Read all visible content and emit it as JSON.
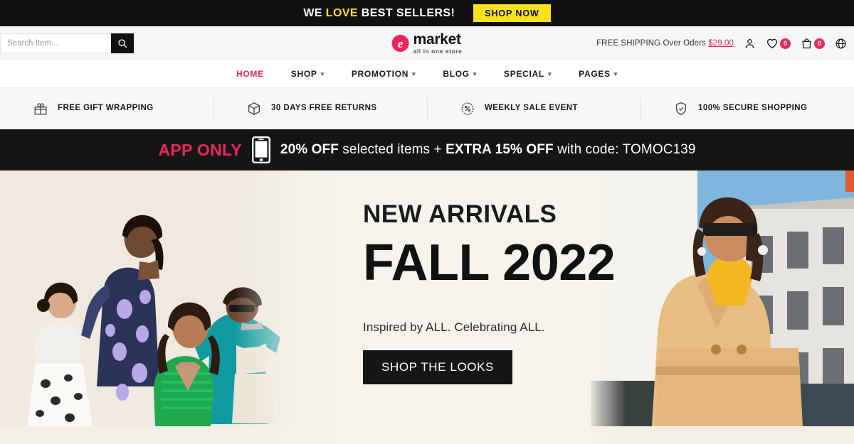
{
  "topbar": {
    "text_before": "WE ",
    "text_highlight": "LOVE",
    "text_after": " BEST SELLERS!",
    "button_label": "SHOP NOW",
    "highlight_color": "#f7e223",
    "button_bg": "#f7e11e"
  },
  "header": {
    "search_placeholder": "Search Item...",
    "search_value": "",
    "logo_mark": "e",
    "logo_name": "market",
    "logo_tagline": "all in one store",
    "shipping_note": "FREE SHIPPING Over Oders ",
    "shipping_price": "$29.00",
    "wishlist_count": "0",
    "cart_count": "0",
    "accent_color": "#e8285c"
  },
  "nav": {
    "items": [
      {
        "label": "HOME",
        "has_chevron": false,
        "active": true
      },
      {
        "label": "SHOP",
        "has_chevron": true,
        "active": false
      },
      {
        "label": "PROMOTION",
        "has_chevron": true,
        "active": false
      },
      {
        "label": "BLOG",
        "has_chevron": true,
        "active": false
      },
      {
        "label": "SPECIAL",
        "has_chevron": true,
        "active": false
      },
      {
        "label": "PAGES",
        "has_chevron": true,
        "active": false
      }
    ]
  },
  "features": [
    {
      "icon": "gift-icon",
      "label": "FREE GIFT WRAPPING"
    },
    {
      "icon": "box-icon",
      "label": "30 DAYS FREE RETURNS"
    },
    {
      "icon": "percent-badge-icon",
      "label": "WEEKLY SALE EVENT"
    },
    {
      "icon": "shield-check-icon",
      "label": "100% SECURE SHOPPING"
    }
  ],
  "appbar": {
    "tag": "APP ONLY",
    "icon": "mobile-phone-icon",
    "discount": "20% OFF",
    "middle": " selected items + ",
    "extra": "EXTRA 15% OFF",
    "code_text": " with code: TOMOC139",
    "tag_color": "#e8285c"
  },
  "hero": {
    "kicker": "NEW ARRIVALS",
    "title": "FALL 2022",
    "subtitle": "Inspired by ALL. Celebrating ALL.",
    "cta_label": "SHOP THE LOOKS"
  }
}
